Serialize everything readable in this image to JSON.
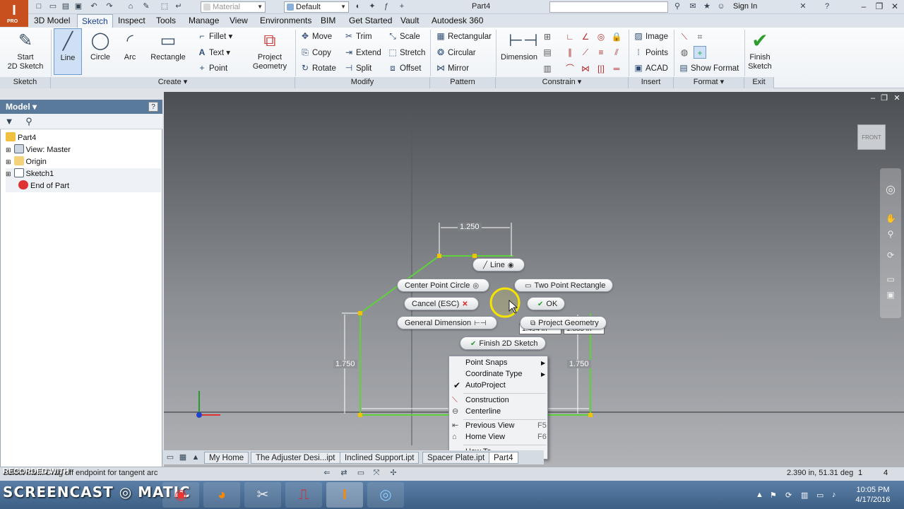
{
  "app": {
    "badge": "I",
    "badge_sub": "PRO",
    "doc_title": "Part4",
    "sign_in": "Sign In"
  },
  "quick_access": {
    "material_placeholder": "Material",
    "appearance_value": "Default"
  },
  "menu_tabs": [
    "3D Model",
    "Sketch",
    "Inspect",
    "Tools",
    "Manage",
    "View",
    "Environments",
    "BIM",
    "Get Started",
    "Vault",
    "Autodesk 360"
  ],
  "ribbon": {
    "start_sketch": "Start\n2D Sketch",
    "line": "Line",
    "circle": "Circle",
    "arc": "Arc",
    "rectangle": "Rectangle",
    "fillet": "Fillet",
    "text": "Text",
    "point": "Point",
    "project_geometry": "Project\nGeometry",
    "move": "Move",
    "copy": "Copy",
    "rotate": "Rotate",
    "trim": "Trim",
    "extend": "Extend",
    "split": "Split",
    "scale": "Scale",
    "stretch": "Stretch",
    "offset": "Offset",
    "rect_pattern": "Rectangular",
    "circ_pattern": "Circular",
    "mirror": "Mirror",
    "dimension": "Dimension",
    "image": "Image",
    "points": "Points",
    "acad": "ACAD",
    "show_format": "Show Format",
    "finish_sketch": "Finish\nSketch",
    "panels": {
      "sketch": "Sketch",
      "create": "Create",
      "modify": "Modify",
      "pattern": "Pattern",
      "constrain": "Constrain",
      "insert": "Insert",
      "format": "Format",
      "exit": "Exit"
    }
  },
  "browser": {
    "title": "Model",
    "help": "?",
    "tree": [
      {
        "label": "Part4"
      },
      {
        "label": "View: Master"
      },
      {
        "label": "Origin"
      },
      {
        "label": "Sketch1"
      },
      {
        "label": "End of Part"
      }
    ]
  },
  "viewcube": "FRONT",
  "sketch": {
    "dim_top": "1.250",
    "dim_left": "1.750",
    "dim_right": "1.750",
    "input_x": "1.494 in",
    "input_y": "1.885 in"
  },
  "marking_menu": {
    "line": "Line",
    "center_point_circle": "Center Point Circle",
    "two_point_rectangle": "Two Point Rectangle",
    "cancel": "Cancel (ESC)",
    "ok": "OK",
    "general_dimension": "General Dimension",
    "project_geometry": "Project Geometry",
    "finish_2d_sketch": "Finish 2D Sketch"
  },
  "context_menu": {
    "point_snaps": "Point Snaps",
    "coordinate_type": "Coordinate Type",
    "autoproject": "AutoProject",
    "construction": "Construction",
    "centerline": "Centerline",
    "previous_view": "Previous View",
    "previous_view_key": "F5",
    "home_view": "Home View",
    "home_view_key": "F6",
    "how_to": "How To..."
  },
  "doc_tabs": [
    "My Home",
    "The Adjuster Desi...ipt",
    "Inclined Support.ipt",
    "Spacer Plate.ipt",
    "Part4"
  ],
  "status": {
    "text": "Select the... Drag off endpoint for tangent arc",
    "coords": "2.390 in, 51.31 deg",
    "count1": "1",
    "count2": "4"
  },
  "taskbar": {
    "watermark": "SCREENCAST",
    "watermark2": "MATIC",
    "recorded": "RECORDED WITH",
    "time": "10:05 PM",
    "date": "4/17/2016"
  },
  "colors": {
    "sketch_line": "#5fd23a",
    "ribbon_active": "#cfe0f5",
    "cursor_halo": "#f4e400"
  }
}
